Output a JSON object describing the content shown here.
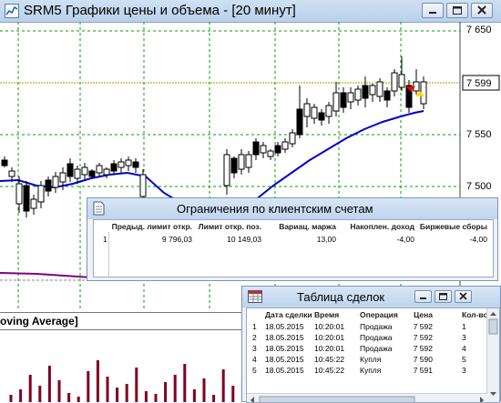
{
  "window": {
    "title": "SRM5 Графики цены и объема - [20 минут]"
  },
  "chart": {
    "price_labels": [
      "7 650",
      "7 599",
      "7 550",
      "7 500"
    ],
    "current_price": "7 599",
    "panel_label": "oving Average]",
    "colors": {
      "background": "#ffffff",
      "grid": "#00a000",
      "candle": "#000000",
      "moving_average": "#0000cc",
      "price_line": "#a0a000",
      "volume": "#800020",
      "indicator_line": "#800080"
    }
  },
  "limits": {
    "title": "Ограничения по клиентским счетам",
    "headers": [
      "Предыд. лимит откр.",
      "Лимит откр. поз.",
      "Вариац. маржа",
      "Накоплен. доход",
      "Биржевые сборы"
    ],
    "rows": [
      {
        "n": "1",
        "prev_limit": "9 796,03",
        "limit": "10 149,03",
        "margin": "13,00",
        "income": "-4,00",
        "fees": "-4,00"
      }
    ]
  },
  "trades": {
    "title": "Таблица сделок",
    "headers": {
      "n": "",
      "date": "Дата сделки",
      "time": "Время",
      "op": "Операция",
      "price": "Цена",
      "qty": "Кол-во"
    },
    "rows": [
      {
        "n": "1",
        "date": "18.05.2015",
        "time": "10:20:01",
        "op": "Продажа",
        "price": "7 592",
        "qty": "1"
      },
      {
        "n": "2",
        "date": "18.05.2015",
        "time": "10:20:01",
        "op": "Продажа",
        "price": "7 592",
        "qty": "3"
      },
      {
        "n": "3",
        "date": "18.05.2015",
        "time": "10:20:01",
        "op": "Продажа",
        "price": "7 592",
        "qty": "4"
      },
      {
        "n": "4",
        "date": "18.05.2015",
        "time": "10:45:22",
        "op": "Купля",
        "price": "7 590",
        "qty": "5"
      },
      {
        "n": "5",
        "date": "18.05.2015",
        "time": "10:45:22",
        "op": "Купля",
        "price": "7 591",
        "qty": "3"
      }
    ]
  }
}
